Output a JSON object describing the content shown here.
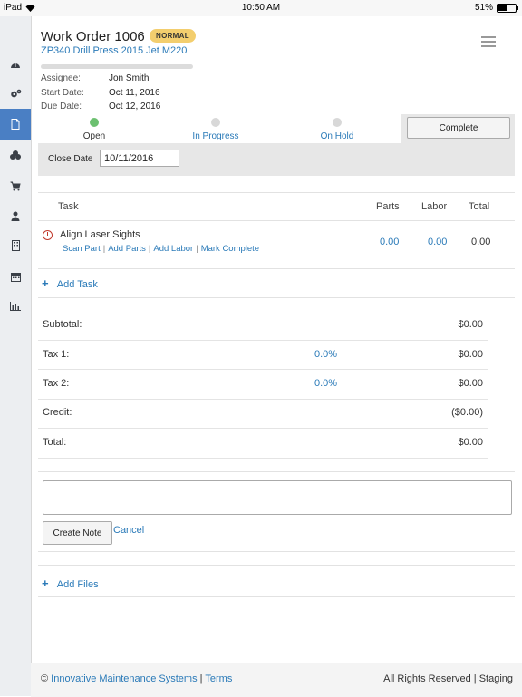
{
  "status_bar": {
    "device": "iPad",
    "time": "10:50 AM",
    "battery": "51%",
    "battery_level": 0.51
  },
  "work_order": {
    "title": "Work Order 1006",
    "priority": "NORMAL",
    "asset": "ZP340 Drill Press 2015 Jet M220",
    "assignee_label": "Assignee:",
    "assignee": "Jon Smith",
    "start_label": "Start Date:",
    "start_date": "Oct 11, 2016",
    "due_label": "Due Date:",
    "due_date": "Oct 12, 2016"
  },
  "stages": [
    {
      "label": "Open",
      "active": true
    },
    {
      "label": "In Progress",
      "active": false
    },
    {
      "label": "On Hold",
      "active": false
    }
  ],
  "complete_button": "Complete",
  "close_date": {
    "label": "Close Date",
    "value": "10/11/2016"
  },
  "task_table": {
    "headers": {
      "task": "Task",
      "parts": "Parts",
      "labor": "Labor",
      "total": "Total"
    },
    "rows": [
      {
        "name": "Align Laser Sights",
        "parts": "0.00",
        "labor": "0.00",
        "total": "0.00",
        "actions": [
          "Scan Part",
          "Add Parts",
          "Add Labor",
          "Mark Complete"
        ]
      }
    ],
    "add_task": "Add Task"
  },
  "totals": {
    "subtotal_label": "Subtotal:",
    "subtotal": "$0.00",
    "tax1_label": "Tax 1:",
    "tax1_rate": "0.0%",
    "tax1": "$0.00",
    "tax2_label": "Tax 2:",
    "tax2_rate": "0.0%",
    "tax2": "$0.00",
    "credit_label": "Credit:",
    "credit": "($0.00)",
    "total_label": "Total:",
    "total": "$0.00"
  },
  "note": {
    "create_label": "Create Note",
    "cancel_label": "Cancel"
  },
  "add_files": "Add Files",
  "footer": {
    "copyright": "©",
    "company": "Innovative Maintenance Systems",
    "sep": "|",
    "terms": "Terms",
    "rights": "All Rights Reserved | Staging"
  },
  "colors": {
    "accent": "#2a7ab8",
    "sidebar_active": "#4a7fc4",
    "badge": "#f3ce6e",
    "open_dot": "#6cc070",
    "alert": "#c0392b"
  },
  "sidebar_icons": [
    "dashboard-icon",
    "gears-icon",
    "document-icon",
    "parts-icon",
    "cart-icon",
    "user-icon",
    "building-icon",
    "calendar-icon",
    "bar-chart-icon"
  ]
}
